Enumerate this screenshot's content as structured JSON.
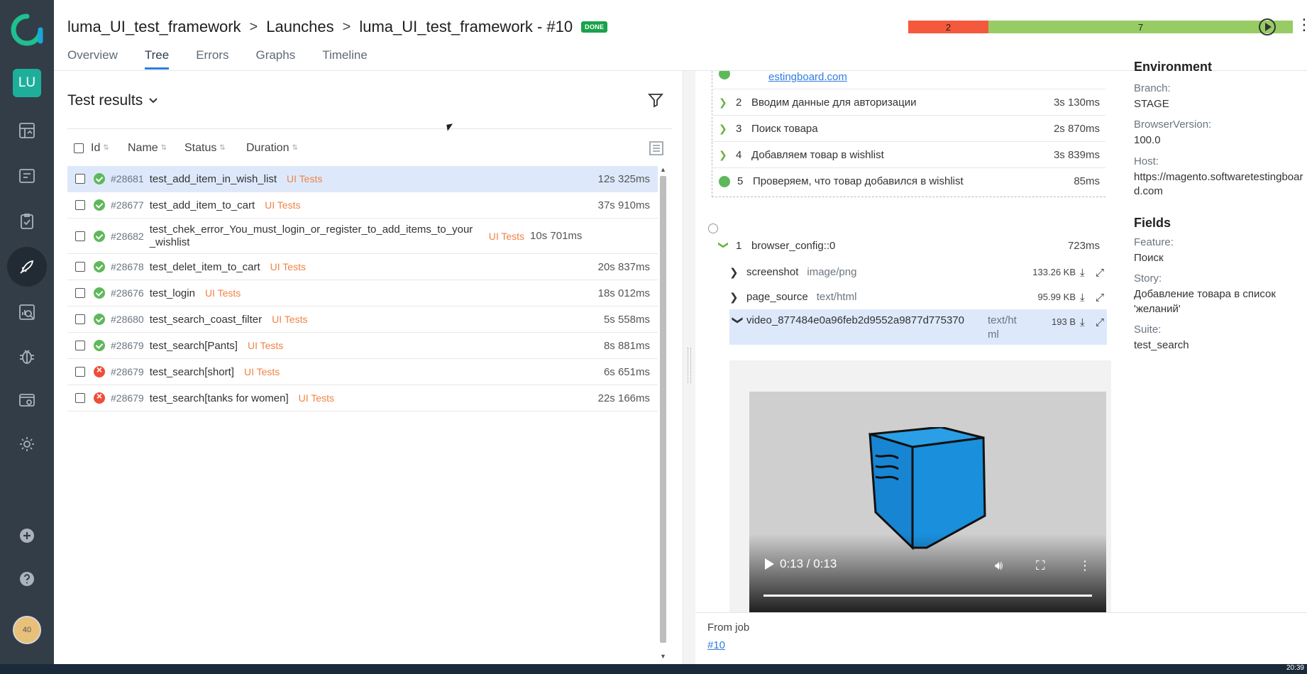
{
  "breadcrumbs": {
    "project": "luma_UI_test_framework",
    "launches": "Launches",
    "launch": "luma_UI_test_framework - #10",
    "status_badge": "DONE"
  },
  "tabs": [
    "Overview",
    "Tree",
    "Errors",
    "Graphs",
    "Timeline"
  ],
  "active_tab": "Tree",
  "statistic": {
    "failed": "2",
    "passed": "7",
    "failed_color": "#f4593d",
    "passed_color": "#97cc64"
  },
  "sidebar": {
    "project_initials": "LU",
    "user_badge": "40"
  },
  "results": {
    "title": "Test results",
    "columns": {
      "id": "Id",
      "name": "Name",
      "status": "Status",
      "duration": "Duration"
    },
    "rows": [
      {
        "status": "passed",
        "id": "#28681",
        "name": "test_add_item_in_wish_list",
        "tag": "UI Tests",
        "duration": "12s 325ms",
        "selected": true
      },
      {
        "status": "passed",
        "id": "#28677",
        "name": "test_add_item_to_cart",
        "tag": "UI Tests",
        "duration": "37s 910ms"
      },
      {
        "status": "passed",
        "id": "#28682",
        "name": "test_chek_error_You_must_login_or_register_to_add_items_to_your_wishlist",
        "tag": "UI Tests",
        "duration": "10s 701ms"
      },
      {
        "status": "passed",
        "id": "#28678",
        "name": "test_delet_item_to_cart",
        "tag": "UI Tests",
        "duration": "20s 837ms"
      },
      {
        "status": "passed",
        "id": "#28676",
        "name": "test_login",
        "tag": "UI Tests",
        "duration": "18s 012ms"
      },
      {
        "status": "passed",
        "id": "#28680",
        "name": "test_search_coast_filter",
        "tag": "UI Tests",
        "duration": "5s 558ms"
      },
      {
        "status": "passed",
        "id": "#28679",
        "name": "test_search[Pants]",
        "tag": "UI Tests",
        "duration": "8s 881ms"
      },
      {
        "status": "failed",
        "id": "#28679",
        "name": "test_search[short]",
        "tag": "UI Tests",
        "duration": "6s 651ms"
      },
      {
        "status": "failed",
        "id": "#28679",
        "name": "test_search[tanks for women]",
        "tag": "UI Tests",
        "duration": "22s 166ms"
      }
    ]
  },
  "steps": {
    "partial_link": "estingboard.com",
    "items": [
      {
        "num": "2",
        "name": "Вводим данные для авторизации",
        "duration": "3s 130ms"
      },
      {
        "num": "3",
        "name": "Поиск товара",
        "duration": "2s 870ms"
      },
      {
        "num": "4",
        "name": "Добавляем товар в wishlist",
        "duration": "3s 839ms"
      },
      {
        "num": "5",
        "name": "Проверяем, что товар добавился в wishlist",
        "duration": "85ms"
      }
    ],
    "fixture": {
      "num": "1",
      "name": "browser_config::0",
      "duration": "723ms"
    },
    "attachments": [
      {
        "name": "screenshot",
        "mime": "image/png",
        "size": "133.26 KB"
      },
      {
        "name": "page_source",
        "mime": "text/html",
        "size": "95.99 KB"
      },
      {
        "name": "video_877484e0a96feb2d9552a9877d775370",
        "mime": "text/html",
        "size": "193 B"
      }
    ],
    "video_time": "0:13 / 0:13"
  },
  "from_job": {
    "label": "From job",
    "link": "#10"
  },
  "info": {
    "environment_title": "Environment",
    "branch_label": "Branch:",
    "branch": "STAGE",
    "browser_label": "BrowserVersion:",
    "browser": "100.0",
    "host_label": "Host:",
    "host": "https://magento.softwaretestingboard.com",
    "fields_title": "Fields",
    "feature_label": "Feature:",
    "feature": "Поиск",
    "story_label": "Story:",
    "story": "Добавление товара в список 'желаний'",
    "suite_label": "Suite:",
    "suite": "test_search"
  },
  "taskbar": {
    "clock": "20:39"
  }
}
